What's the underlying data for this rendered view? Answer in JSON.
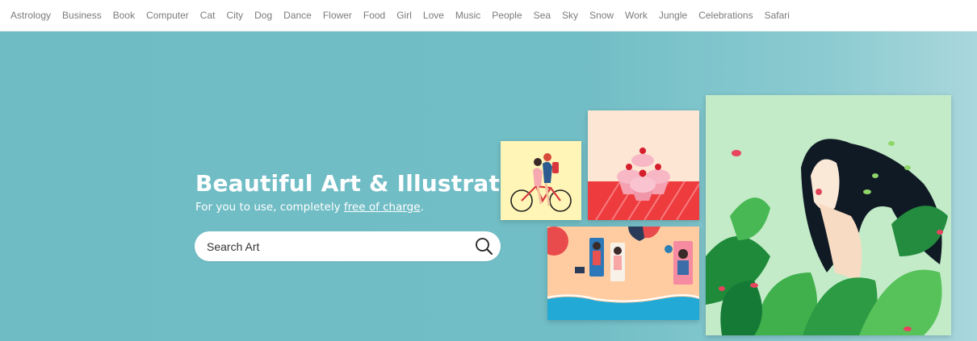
{
  "nav": {
    "categories": [
      "Astrology",
      "Business",
      "Book",
      "Computer",
      "Cat",
      "City",
      "Dog",
      "Dance",
      "Flower",
      "Food",
      "Girl",
      "Love",
      "Music",
      "People",
      "Sea",
      "Sky",
      "Snow",
      "Work",
      "Jungle",
      "Celebrations",
      "Safari"
    ]
  },
  "hero": {
    "title": "Beautiful Art & Illustration",
    "subtitle_prefix": "For you to use, completely ",
    "subtitle_link": "free of charge",
    "subtitle_suffix": "."
  },
  "search": {
    "placeholder": "Search Art"
  },
  "colors": {
    "hero_bg": "#6fbcc4",
    "nav_text": "#7b7b7b"
  },
  "icons": {
    "search": "search-icon"
  }
}
